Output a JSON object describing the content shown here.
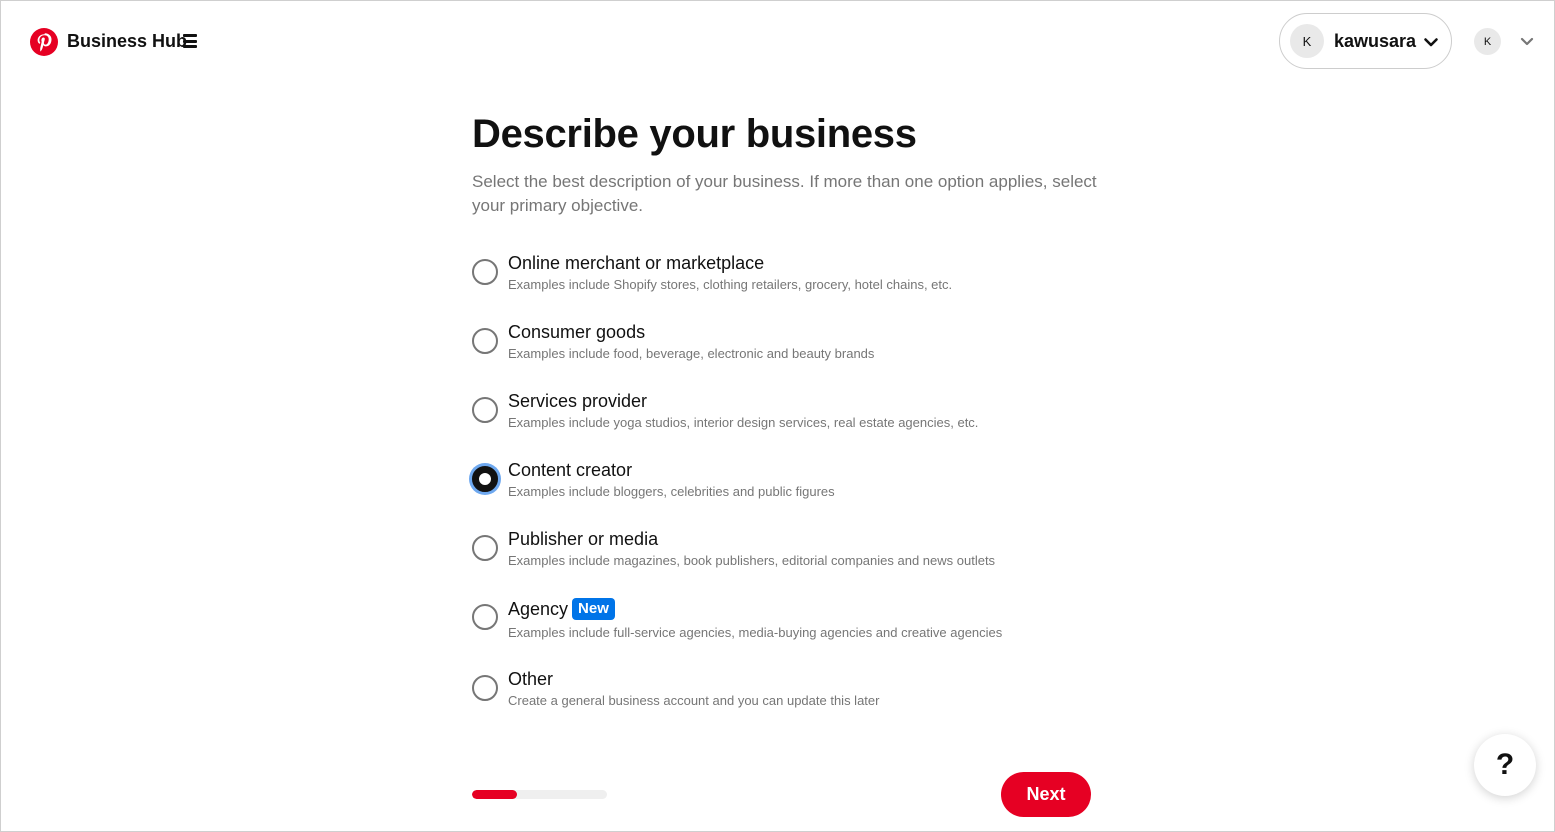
{
  "header": {
    "brand": "Business Hub",
    "account": {
      "avatar_initial": "K",
      "username": "kawusara"
    },
    "profile_avatar_initial": "K"
  },
  "main": {
    "title": "Describe your business",
    "subtitle": "Select the best description of your business. If more than one option applies, select your primary objective.",
    "options": [
      {
        "label": "Online merchant or marketplace",
        "description": "Examples include Shopify stores, clothing retailers, grocery, hotel chains, etc.",
        "selected": false
      },
      {
        "label": "Consumer goods",
        "description": "Examples include food, beverage, electronic and beauty brands",
        "selected": false
      },
      {
        "label": "Services provider",
        "description": "Examples include yoga studios, interior design services, real estate agencies, etc.",
        "selected": false
      },
      {
        "label": "Content creator",
        "description": "Examples include bloggers, celebrities and public figures",
        "selected": true
      },
      {
        "label": "Publisher or media",
        "description": "Examples include magazines, book publishers, editorial companies and news outlets",
        "selected": false
      },
      {
        "label": "Agency",
        "badge": "New",
        "description": "Examples include full-service agencies, media-buying agencies and creative agencies",
        "selected": false
      },
      {
        "label": "Other",
        "description": "Create a general business account and you can update this later",
        "selected": false
      }
    ]
  },
  "footer": {
    "progress_fraction": 0.33,
    "next_label": "Next"
  },
  "help": {
    "label": "?"
  },
  "colors": {
    "brand_red": "#e60023",
    "badge_blue": "#0074e8",
    "muted_text": "#767676",
    "focus_ring": "#6ea8ef"
  },
  "icons": {
    "logo": "pinterest-logo",
    "menu": "hamburger-menu-icon",
    "chevron": "chevron-down-icon"
  }
}
